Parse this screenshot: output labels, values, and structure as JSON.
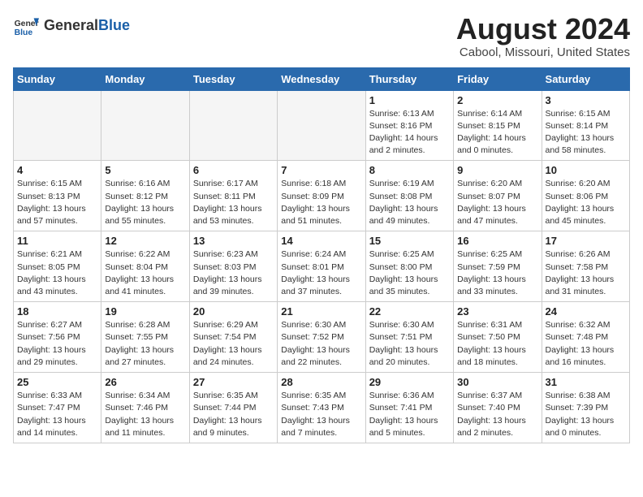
{
  "header": {
    "logo_general": "General",
    "logo_blue": "Blue",
    "month_title": "August 2024",
    "location": "Cabool, Missouri, United States"
  },
  "weekdays": [
    "Sunday",
    "Monday",
    "Tuesday",
    "Wednesday",
    "Thursday",
    "Friday",
    "Saturday"
  ],
  "weeks": [
    [
      {
        "day": "",
        "info": ""
      },
      {
        "day": "",
        "info": ""
      },
      {
        "day": "",
        "info": ""
      },
      {
        "day": "",
        "info": ""
      },
      {
        "day": "1",
        "info": "Sunrise: 6:13 AM\nSunset: 8:16 PM\nDaylight: 14 hours\nand 2 minutes."
      },
      {
        "day": "2",
        "info": "Sunrise: 6:14 AM\nSunset: 8:15 PM\nDaylight: 14 hours\nand 0 minutes."
      },
      {
        "day": "3",
        "info": "Sunrise: 6:15 AM\nSunset: 8:14 PM\nDaylight: 13 hours\nand 58 minutes."
      }
    ],
    [
      {
        "day": "4",
        "info": "Sunrise: 6:15 AM\nSunset: 8:13 PM\nDaylight: 13 hours\nand 57 minutes."
      },
      {
        "day": "5",
        "info": "Sunrise: 6:16 AM\nSunset: 8:12 PM\nDaylight: 13 hours\nand 55 minutes."
      },
      {
        "day": "6",
        "info": "Sunrise: 6:17 AM\nSunset: 8:11 PM\nDaylight: 13 hours\nand 53 minutes."
      },
      {
        "day": "7",
        "info": "Sunrise: 6:18 AM\nSunset: 8:09 PM\nDaylight: 13 hours\nand 51 minutes."
      },
      {
        "day": "8",
        "info": "Sunrise: 6:19 AM\nSunset: 8:08 PM\nDaylight: 13 hours\nand 49 minutes."
      },
      {
        "day": "9",
        "info": "Sunrise: 6:20 AM\nSunset: 8:07 PM\nDaylight: 13 hours\nand 47 minutes."
      },
      {
        "day": "10",
        "info": "Sunrise: 6:20 AM\nSunset: 8:06 PM\nDaylight: 13 hours\nand 45 minutes."
      }
    ],
    [
      {
        "day": "11",
        "info": "Sunrise: 6:21 AM\nSunset: 8:05 PM\nDaylight: 13 hours\nand 43 minutes."
      },
      {
        "day": "12",
        "info": "Sunrise: 6:22 AM\nSunset: 8:04 PM\nDaylight: 13 hours\nand 41 minutes."
      },
      {
        "day": "13",
        "info": "Sunrise: 6:23 AM\nSunset: 8:03 PM\nDaylight: 13 hours\nand 39 minutes."
      },
      {
        "day": "14",
        "info": "Sunrise: 6:24 AM\nSunset: 8:01 PM\nDaylight: 13 hours\nand 37 minutes."
      },
      {
        "day": "15",
        "info": "Sunrise: 6:25 AM\nSunset: 8:00 PM\nDaylight: 13 hours\nand 35 minutes."
      },
      {
        "day": "16",
        "info": "Sunrise: 6:25 AM\nSunset: 7:59 PM\nDaylight: 13 hours\nand 33 minutes."
      },
      {
        "day": "17",
        "info": "Sunrise: 6:26 AM\nSunset: 7:58 PM\nDaylight: 13 hours\nand 31 minutes."
      }
    ],
    [
      {
        "day": "18",
        "info": "Sunrise: 6:27 AM\nSunset: 7:56 PM\nDaylight: 13 hours\nand 29 minutes."
      },
      {
        "day": "19",
        "info": "Sunrise: 6:28 AM\nSunset: 7:55 PM\nDaylight: 13 hours\nand 27 minutes."
      },
      {
        "day": "20",
        "info": "Sunrise: 6:29 AM\nSunset: 7:54 PM\nDaylight: 13 hours\nand 24 minutes."
      },
      {
        "day": "21",
        "info": "Sunrise: 6:30 AM\nSunset: 7:52 PM\nDaylight: 13 hours\nand 22 minutes."
      },
      {
        "day": "22",
        "info": "Sunrise: 6:30 AM\nSunset: 7:51 PM\nDaylight: 13 hours\nand 20 minutes."
      },
      {
        "day": "23",
        "info": "Sunrise: 6:31 AM\nSunset: 7:50 PM\nDaylight: 13 hours\nand 18 minutes."
      },
      {
        "day": "24",
        "info": "Sunrise: 6:32 AM\nSunset: 7:48 PM\nDaylight: 13 hours\nand 16 minutes."
      }
    ],
    [
      {
        "day": "25",
        "info": "Sunrise: 6:33 AM\nSunset: 7:47 PM\nDaylight: 13 hours\nand 14 minutes."
      },
      {
        "day": "26",
        "info": "Sunrise: 6:34 AM\nSunset: 7:46 PM\nDaylight: 13 hours\nand 11 minutes."
      },
      {
        "day": "27",
        "info": "Sunrise: 6:35 AM\nSunset: 7:44 PM\nDaylight: 13 hours\nand 9 minutes."
      },
      {
        "day": "28",
        "info": "Sunrise: 6:35 AM\nSunset: 7:43 PM\nDaylight: 13 hours\nand 7 minutes."
      },
      {
        "day": "29",
        "info": "Sunrise: 6:36 AM\nSunset: 7:41 PM\nDaylight: 13 hours\nand 5 minutes."
      },
      {
        "day": "30",
        "info": "Sunrise: 6:37 AM\nSunset: 7:40 PM\nDaylight: 13 hours\nand 2 minutes."
      },
      {
        "day": "31",
        "info": "Sunrise: 6:38 AM\nSunset: 7:39 PM\nDaylight: 13 hours\nand 0 minutes."
      }
    ]
  ]
}
